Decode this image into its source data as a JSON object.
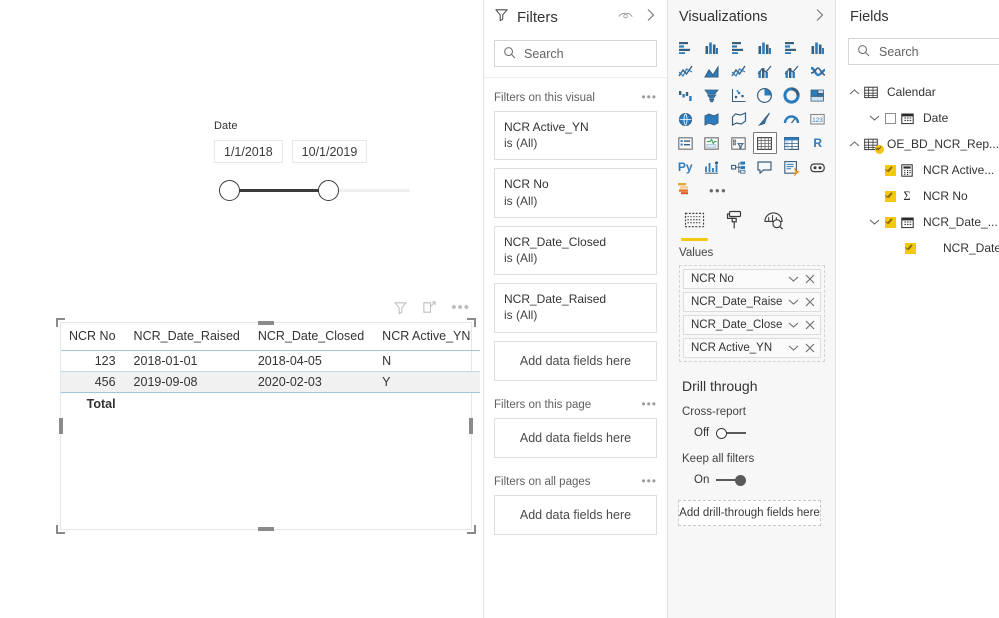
{
  "canvas": {
    "slicer": {
      "title": "Date",
      "start_value": "1/1/2018",
      "end_value": "10/1/2019"
    },
    "visual": {
      "header_icons": [
        "filter-icon",
        "focus-mode-icon",
        "more-options-icon"
      ],
      "table": {
        "columns": [
          "NCR No",
          "NCR_Date_Raised",
          "NCR_Date_Closed",
          "NCR Active_YN"
        ],
        "rows": [
          [
            "123",
            "2018-01-01",
            "2018-04-05",
            "N"
          ],
          [
            "456",
            "2019-09-08",
            "2020-02-03",
            "Y"
          ]
        ],
        "total_label": "Total"
      }
    }
  },
  "filters": {
    "title": "Filters",
    "search_placeholder": "Search",
    "sections": [
      {
        "title": "Filters on this visual",
        "cards": [
          {
            "name": "NCR Active_YN",
            "state": "is (All)"
          },
          {
            "name": "NCR No",
            "state": "is (All)"
          },
          {
            "name": "NCR_Date_Closed",
            "state": "is (All)"
          },
          {
            "name": "NCR_Date_Raised",
            "state": "is (All)"
          }
        ],
        "dropzone": "Add data fields here"
      },
      {
        "title": "Filters on this page",
        "cards": [],
        "dropzone": "Add data fields here"
      },
      {
        "title": "Filters on all pages",
        "cards": [],
        "dropzone": "Add data fields here"
      }
    ]
  },
  "visualizations": {
    "title": "Visualizations",
    "gallery": [
      "stacked-bar-chart-icon",
      "stacked-column-chart-icon",
      "clustered-bar-chart-icon",
      "clustered-column-chart-icon",
      "100-stacked-bar-chart-icon",
      "100-stacked-column-chart-icon",
      "line-chart-icon",
      "area-chart-icon",
      "stacked-area-chart-icon",
      "line-stacked-column-chart-icon",
      "line-clustered-column-chart-icon",
      "ribbon-chart-icon",
      "waterfall-chart-icon",
      "funnel-chart-icon",
      "scatter-chart-icon",
      "pie-chart-icon",
      "donut-chart-icon",
      "treemap-icon",
      "map-icon",
      "filled-map-icon",
      "shape-map-icon",
      "arcgis-map-icon",
      "gauge-icon",
      "card-icon",
      "multi-row-card-icon",
      "kpi-icon",
      "slicer-icon",
      "table-icon",
      "matrix-icon",
      "r-script-visual-icon",
      "python-visual-icon",
      "key-influencers-icon",
      "decomposition-tree-icon",
      "q-and-a-icon",
      "smart-narrative-icon",
      "paginated-report-icon",
      "power-apps-icon"
    ],
    "gallery_text_icons": {
      "r-script-visual-icon": "R",
      "python-visual-icon": "Py"
    },
    "selected_visual": "table-icon",
    "more_label": "more-options-icon",
    "tabs": [
      {
        "name": "fields-tab",
        "active": true
      },
      {
        "name": "format-tab",
        "active": false
      },
      {
        "name": "analytics-tab",
        "active": false
      }
    ],
    "wells": {
      "label": "Values",
      "items": [
        "NCR No",
        "NCR_Date_Raised",
        "NCR_Date_Closed",
        "NCR Active_YN"
      ]
    },
    "drill_through": {
      "title": "Drill through",
      "cross_report_label": "Cross-report",
      "cross_report_state": "Off",
      "keep_all_filters_label": "Keep all filters",
      "keep_all_filters_state": "On",
      "dropzone": "Add drill-through fields here"
    }
  },
  "fields": {
    "title": "Fields",
    "search_placeholder": "Search",
    "tree": [
      {
        "label": "Calendar",
        "type": "table",
        "expanded": true,
        "indent": 0,
        "checkbox": "none",
        "chevron": "up"
      },
      {
        "label": "Date",
        "type": "date-field",
        "expanded": false,
        "indent": 1,
        "checkbox": "off",
        "chevron": "down"
      },
      {
        "label": "OE_BD_NCR_Rep...",
        "type": "table-badged",
        "expanded": true,
        "indent": 0,
        "checkbox": "none",
        "chevron": "up"
      },
      {
        "label": "NCR Active...",
        "type": "calculator-field",
        "expanded": false,
        "indent": 1,
        "checkbox": "on",
        "chevron": "none"
      },
      {
        "label": "NCR No",
        "type": "sum-field",
        "expanded": false,
        "indent": 1,
        "checkbox": "on",
        "chevron": "none"
      },
      {
        "label": "NCR_Date_...",
        "type": "date-field",
        "expanded": true,
        "indent": 1,
        "checkbox": "on",
        "chevron": "down"
      },
      {
        "label": "NCR_Date_...",
        "type": "plain-field",
        "expanded": false,
        "indent": 2,
        "checkbox": "on",
        "chevron": "none"
      }
    ]
  },
  "colors": {
    "accent_yellow": "#f2c811",
    "chart_icon_blue": "#2b7cbf",
    "table_rule_blue": "#9fc4dd",
    "alt_row_gray": "#f1f1f1",
    "pane_gray": "#f7f7f7"
  }
}
